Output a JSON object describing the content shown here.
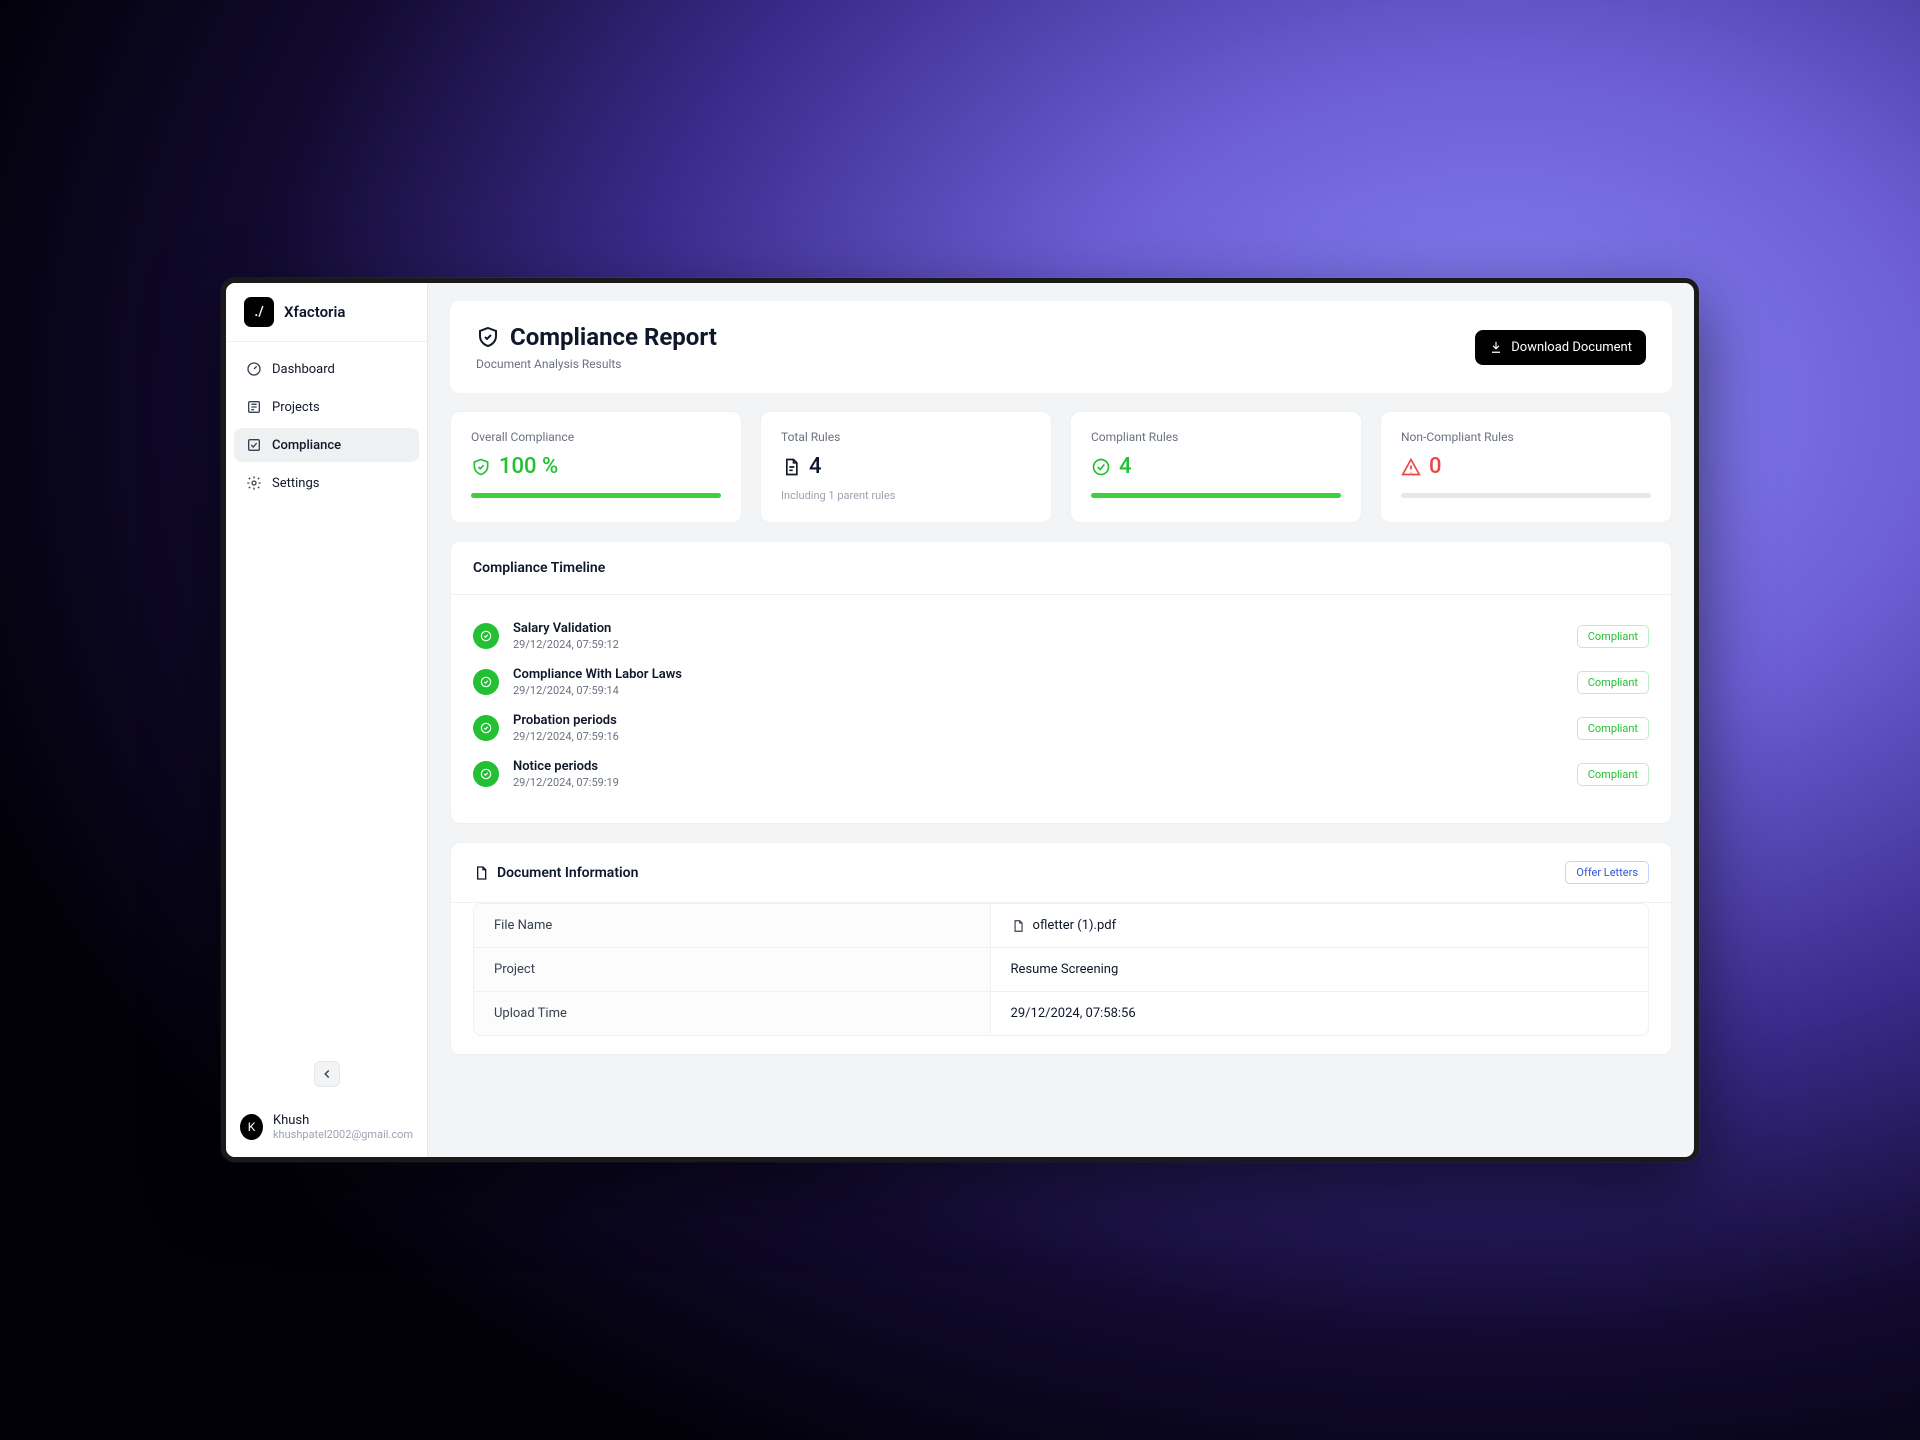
{
  "brand": {
    "name": "Xfactoria",
    "logo_glyph": "./"
  },
  "sidebar": {
    "items": [
      {
        "label": "Dashboard"
      },
      {
        "label": "Projects"
      },
      {
        "label": "Compliance"
      },
      {
        "label": "Settings"
      }
    ]
  },
  "user": {
    "name": "Khush",
    "email": "khushpatel2002@gmail.com",
    "initial": "K"
  },
  "header": {
    "title": "Compliance Report",
    "subtitle": "Document Analysis Results",
    "download_label": "Download Document"
  },
  "stats": {
    "overall": {
      "label": "Overall Compliance",
      "value": "100 %",
      "progress_pct": 100
    },
    "total": {
      "label": "Total Rules",
      "value": "4",
      "subtext": "Including 1 parent rules"
    },
    "compliant": {
      "label": "Compliant Rules",
      "value": "4",
      "progress_pct": 100
    },
    "noncompliant": {
      "label": "Non-Compliant Rules",
      "value": "0",
      "progress_pct": 0
    }
  },
  "timeline": {
    "title": "Compliance Timeline",
    "items": [
      {
        "title": "Salary Validation",
        "time": "29/12/2024, 07:59:12",
        "status": "Compliant"
      },
      {
        "title": "Compliance With Labor Laws",
        "time": "29/12/2024, 07:59:14",
        "status": "Compliant"
      },
      {
        "title": "Probation periods",
        "time": "29/12/2024, 07:59:16",
        "status": "Compliant"
      },
      {
        "title": "Notice periods",
        "time": "29/12/2024, 07:59:19",
        "status": "Compliant"
      }
    ]
  },
  "docinfo": {
    "title": "Document Information",
    "badge": "Offer Letters",
    "rows": [
      {
        "key": "File Name",
        "value": "ofletter (1).pdf",
        "has_icon": true
      },
      {
        "key": "Project",
        "value": "Resume Screening"
      },
      {
        "key": "Upload Time",
        "value": "29/12/2024, 07:58:56"
      }
    ]
  }
}
